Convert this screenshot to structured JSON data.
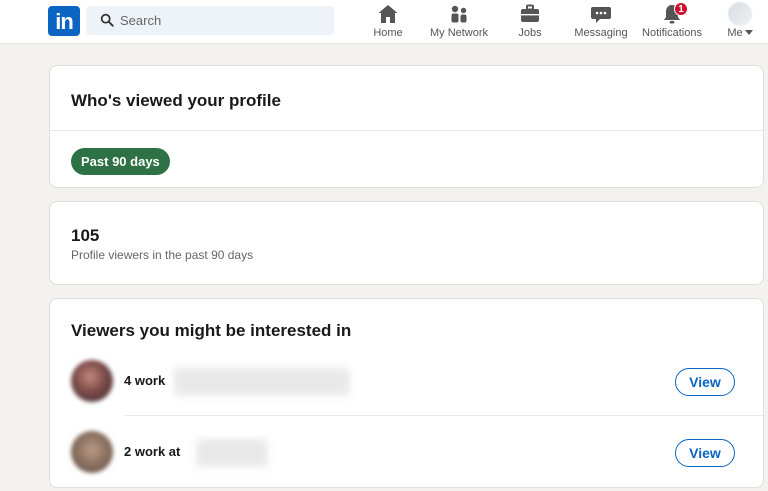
{
  "nav": {
    "logo_text": "in",
    "search_placeholder": "Search",
    "items": [
      {
        "label": "Home",
        "icon": "home-icon"
      },
      {
        "label": "My Network",
        "icon": "network-icon"
      },
      {
        "label": "Jobs",
        "icon": "briefcase-icon"
      },
      {
        "label": "Messaging",
        "icon": "messaging-icon"
      },
      {
        "label": "Notifications",
        "icon": "bell-icon",
        "badge": "1"
      },
      {
        "label": "Me",
        "icon": "avatar"
      }
    ]
  },
  "profile_views": {
    "title": "Who's viewed your profile",
    "filter_label": "Past 90 days"
  },
  "stats": {
    "count": "105",
    "caption": "Profile viewers in the past 90 days"
  },
  "viewers": {
    "title": "Viewers you might be interested in",
    "items": [
      {
        "text": "4 work",
        "button": "View"
      },
      {
        "text": "2 work at",
        "button": "View"
      }
    ]
  },
  "colors": {
    "brand": "#0a66c2",
    "filter_pill": "#2e7144",
    "badge": "#cb112d",
    "page_bg": "#f4f2ee"
  }
}
